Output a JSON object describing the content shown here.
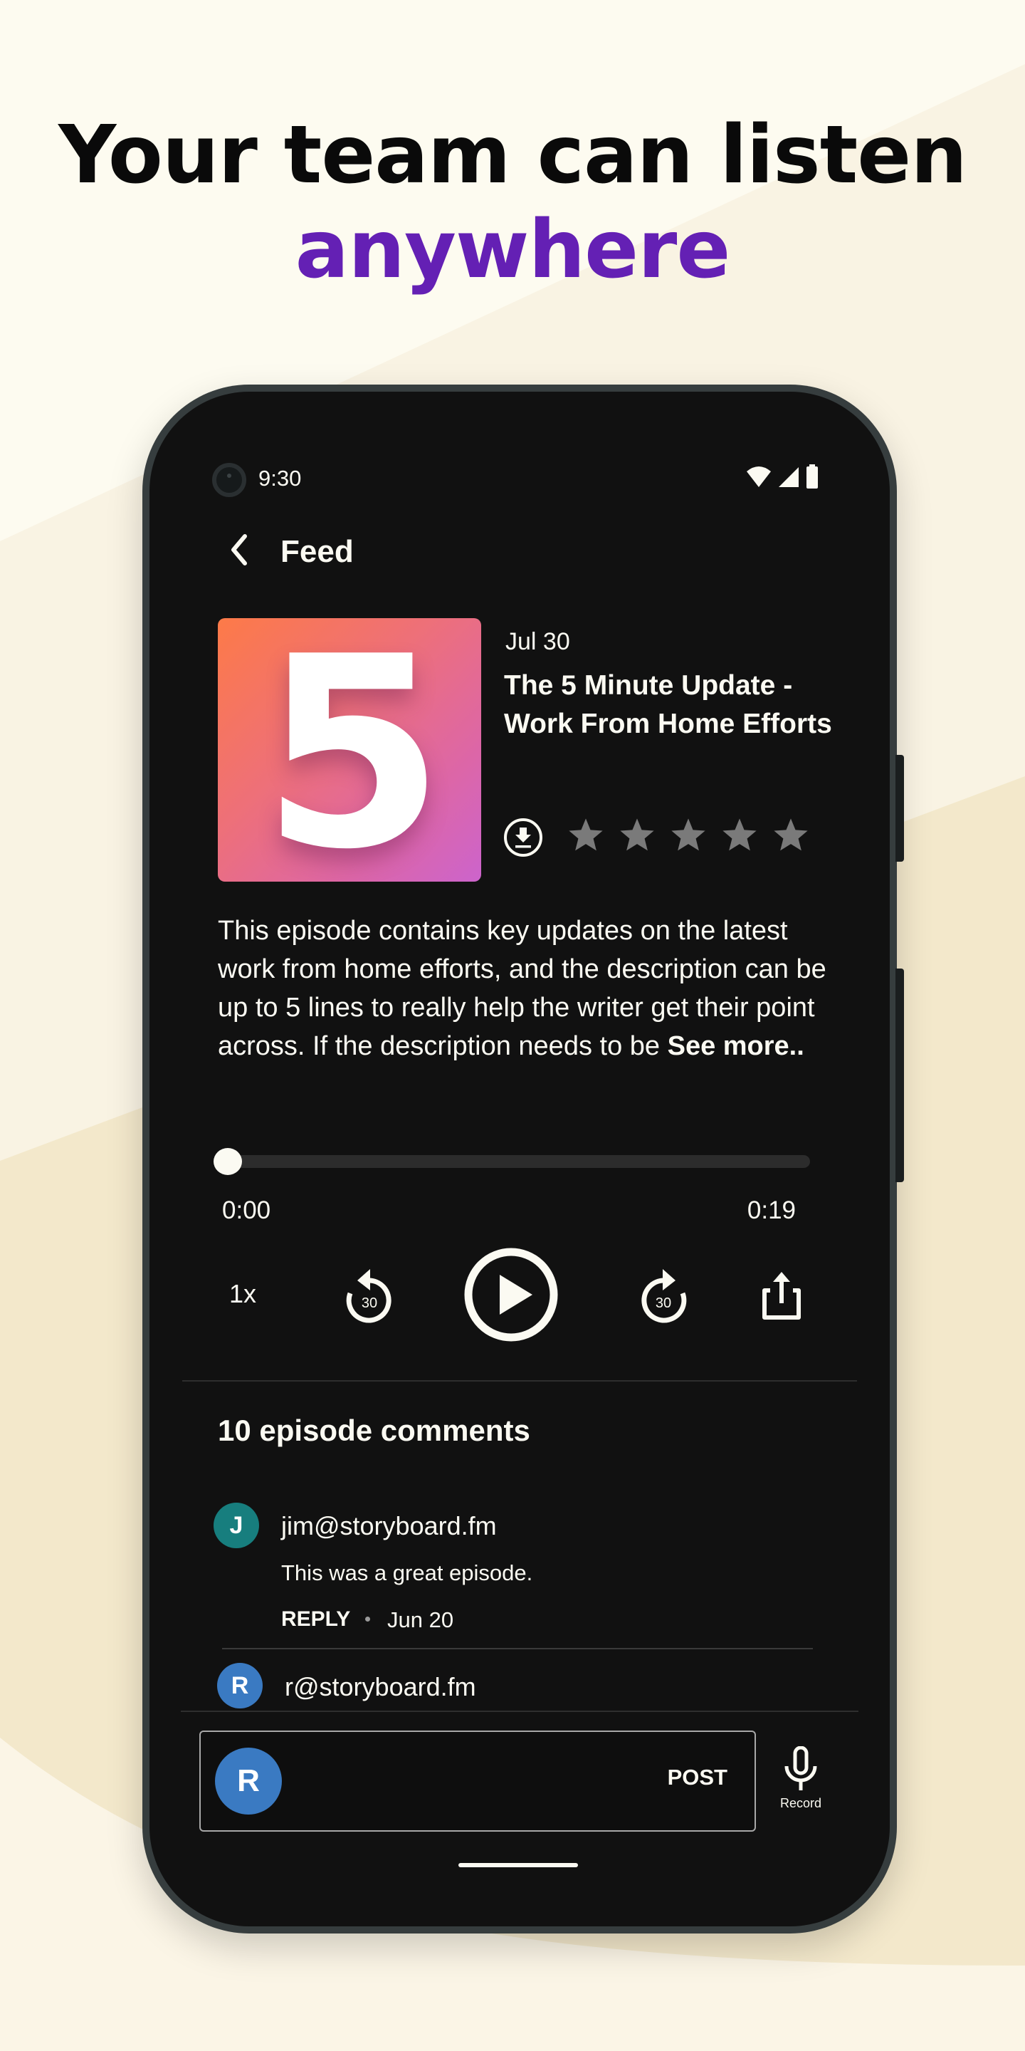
{
  "promo": {
    "headline_line1": "Your team can listen",
    "headline_line2": "anywhere",
    "accent_color": "#6420b4"
  },
  "status_bar": {
    "time": "9:30",
    "icons": [
      "wifi-icon",
      "signal-icon",
      "battery-icon"
    ]
  },
  "app_bar": {
    "back_icon": "chevron-left-icon",
    "title": "Feed"
  },
  "episode": {
    "artwork_text": "5",
    "date": "Jul 30",
    "title": "The 5 Minute Update - Work From Home Efforts",
    "download_icon": "download-circle-icon",
    "rating": {
      "value": 0,
      "max": 5
    },
    "description": "This episode contains key updates on the latest work from home efforts, and the description can be up to 5 lines to really help the writer get their point across. If the description needs to be ",
    "see_more_label": "See more.."
  },
  "player": {
    "progress_fraction": 0,
    "time_current": "0:00",
    "time_total": "0:19",
    "speed_label": "1x",
    "rewind_label": "30",
    "forward_label": "30",
    "icons": [
      "rewind-30-icon",
      "play-icon",
      "forward-30-icon",
      "share-icon"
    ]
  },
  "comments": {
    "title": "10 episode comments",
    "items": [
      {
        "avatar_initial": "J",
        "avatar_color": "#177e7e",
        "author": "jim@storyboard.fm",
        "text": "This was a great episode.",
        "reply_label": "REPLY",
        "date": "Jun 20"
      },
      {
        "avatar_initial": "R",
        "avatar_color": "#3a7ac2",
        "author": "r@storyboard.fm"
      }
    ]
  },
  "composer": {
    "avatar_initial": "R",
    "avatar_color": "#3a7ac2",
    "input_value": "",
    "input_placeholder": "",
    "post_label": "POST",
    "record_label": "Record"
  }
}
